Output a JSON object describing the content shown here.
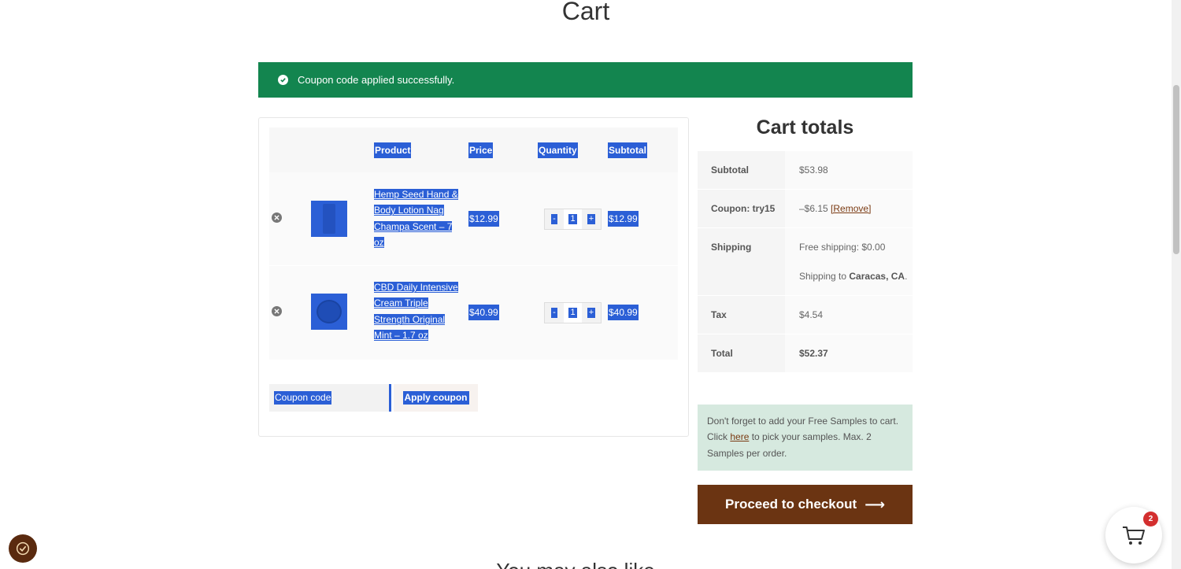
{
  "page": {
    "title": "Cart"
  },
  "notice": {
    "message": "Coupon code applied successfully.",
    "color": "#13854f"
  },
  "table": {
    "headers": {
      "product": "Product",
      "price": "Price",
      "quantity": "Quantity",
      "subtotal": "Subtotal"
    },
    "items": [
      {
        "name": "Hemp Seed Hand & Body Lotion Nag Champa Scent – 7 oz",
        "price": "$12.99",
        "quantity": "1",
        "subtotal": "$12.99",
        "minus": "-",
        "plus": "+"
      },
      {
        "name": "CBD Daily Intensive Cream Triple Strength Original Mint – 1.7 oz",
        "price": "$40.99",
        "quantity": "1",
        "subtotal": "$40.99",
        "minus": "-",
        "plus": "+"
      }
    ]
  },
  "coupon": {
    "placeholder": "Coupon code",
    "apply_label": "Apply coupon"
  },
  "totals": {
    "title": "Cart totals",
    "subtotal_label": "Subtotal",
    "subtotal_value": "$53.98",
    "coupon_label": "Coupon: try15",
    "coupon_value": "–$6.15",
    "coupon_remove": "[Remove]",
    "shipping_label": "Shipping",
    "shipping_value": "Free shipping: $0.00",
    "shipping_to_prefix": "Shipping to",
    "shipping_to_place": "Caracas, CA",
    "shipping_to_suffix": ".",
    "tax_label": "Tax",
    "tax_value": "$4.54",
    "total_label": "Total",
    "total_value": "$52.37"
  },
  "samples": {
    "text_before": "Don't forget to add your Free Samples to cart. Click",
    "link": "here",
    "text_after": "to pick your samples. Max. 2 Samples per order."
  },
  "checkout": {
    "label": "Proceed to checkout",
    "arrow": "⟶",
    "color": "#6b3412"
  },
  "mini_cart": {
    "count": "2"
  },
  "footer": {
    "peek_text": "You may also like…"
  }
}
